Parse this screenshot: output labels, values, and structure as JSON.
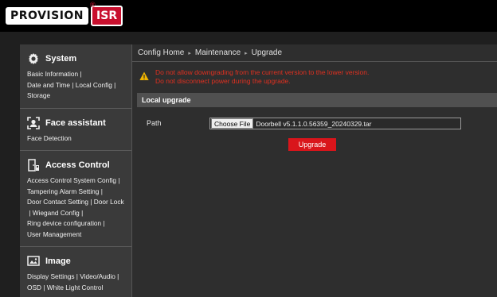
{
  "brand": {
    "logo_text": "PROVISION",
    "logo_mark": "ISR",
    "registered": "®"
  },
  "breadcrumb": {
    "items": [
      "Config Home",
      "Maintenance",
      "Upgrade"
    ],
    "separator": "▸"
  },
  "sidebar": {
    "sections": [
      {
        "title": "System",
        "icon": "gear-icon",
        "links": [
          "Basic Information",
          "Date and Time",
          "Local Config",
          "Storage"
        ]
      },
      {
        "title": "Face assistant",
        "icon": "face-scan-icon",
        "links": [
          "Face Detection"
        ]
      },
      {
        "title": "Access Control",
        "icon": "door-access-icon",
        "links": [
          "Access Control System Config",
          "Tampering Alarm Setting",
          "Door Contact Setting",
          "Door Lock",
          "Wiegand Config",
          "Ring device configuration",
          "User Management"
        ]
      },
      {
        "title": "Image",
        "icon": "image-icon",
        "links": [
          "Display Settings",
          "Video/Audio",
          "OSD",
          "White Light Control"
        ]
      }
    ]
  },
  "warning": {
    "line1": "Do not allow downgrading from the current version to the lower version.",
    "line2": "Do not disconnect power during the upgrade.",
    "icon": "warning-icon",
    "color": "#e03020"
  },
  "local_upgrade": {
    "header": "Local upgrade",
    "path_label": "Path",
    "choose_file_label": "Choose File",
    "file_name": "Doorbell v5.1.1.0.56359_20240329.tar",
    "upgrade_label": "Upgrade",
    "accent": "#d9151b"
  }
}
